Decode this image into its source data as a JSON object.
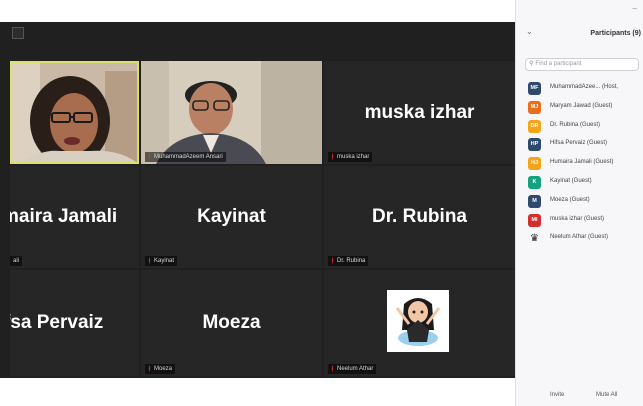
{
  "tiles": [
    {
      "name": "",
      "label": "",
      "type": "video-woman"
    },
    {
      "name": "",
      "label": "MuhammadAzeem Ansari",
      "type": "video-man"
    },
    {
      "name": "muska izhar",
      "label": "muska izhar",
      "type": "name"
    },
    {
      "name": "maira Jamali",
      "label": "ali",
      "type": "name"
    },
    {
      "name": "Kayinat",
      "label": "Kayinat",
      "type": "name"
    },
    {
      "name": "Dr. Rubina",
      "label": "Dr. Rubina",
      "type": "name"
    },
    {
      "name": "fsa Pervaiz",
      "label": "",
      "type": "name"
    },
    {
      "name": "Moeza",
      "label": "Moeza",
      "type": "name"
    },
    {
      "name": "",
      "label": "Neelum Athar",
      "type": "avatar-img"
    }
  ],
  "panel": {
    "title": "Participants (9)",
    "search_placeholder": "Find a participant",
    "participants": [
      {
        "initials": "MF",
        "color": "#2f4a6d",
        "name": "MuhammadAzee... (Host,"
      },
      {
        "initials": "MJ",
        "color": "#e8701a",
        "name": "Maryam Jawad (Guest)"
      },
      {
        "initials": "DR",
        "color": "#f4a419",
        "name": "Dr. Rubina (Guest)"
      },
      {
        "initials": "HP",
        "color": "#2f4a6d",
        "name": "Hifsa Pervaiz (Guest)"
      },
      {
        "initials": "HJ",
        "color": "#f4a419",
        "name": "Humaira Jamali (Guest)"
      },
      {
        "initials": "K",
        "color": "#15a37f",
        "name": "Kayinat (Guest)"
      },
      {
        "initials": "M",
        "color": "#2f4a6d",
        "name": "Moeza (Guest)"
      },
      {
        "initials": "MI",
        "color": "#d32f2f",
        "name": "muska izhar (Guest)"
      },
      {
        "initials": "",
        "color": "#ffffff",
        "name": "Neelum Athar (Guest)",
        "avatar": "woman-avatar-icon"
      }
    ],
    "invite_label": "Invite",
    "mute_all_label": "Mute All"
  }
}
